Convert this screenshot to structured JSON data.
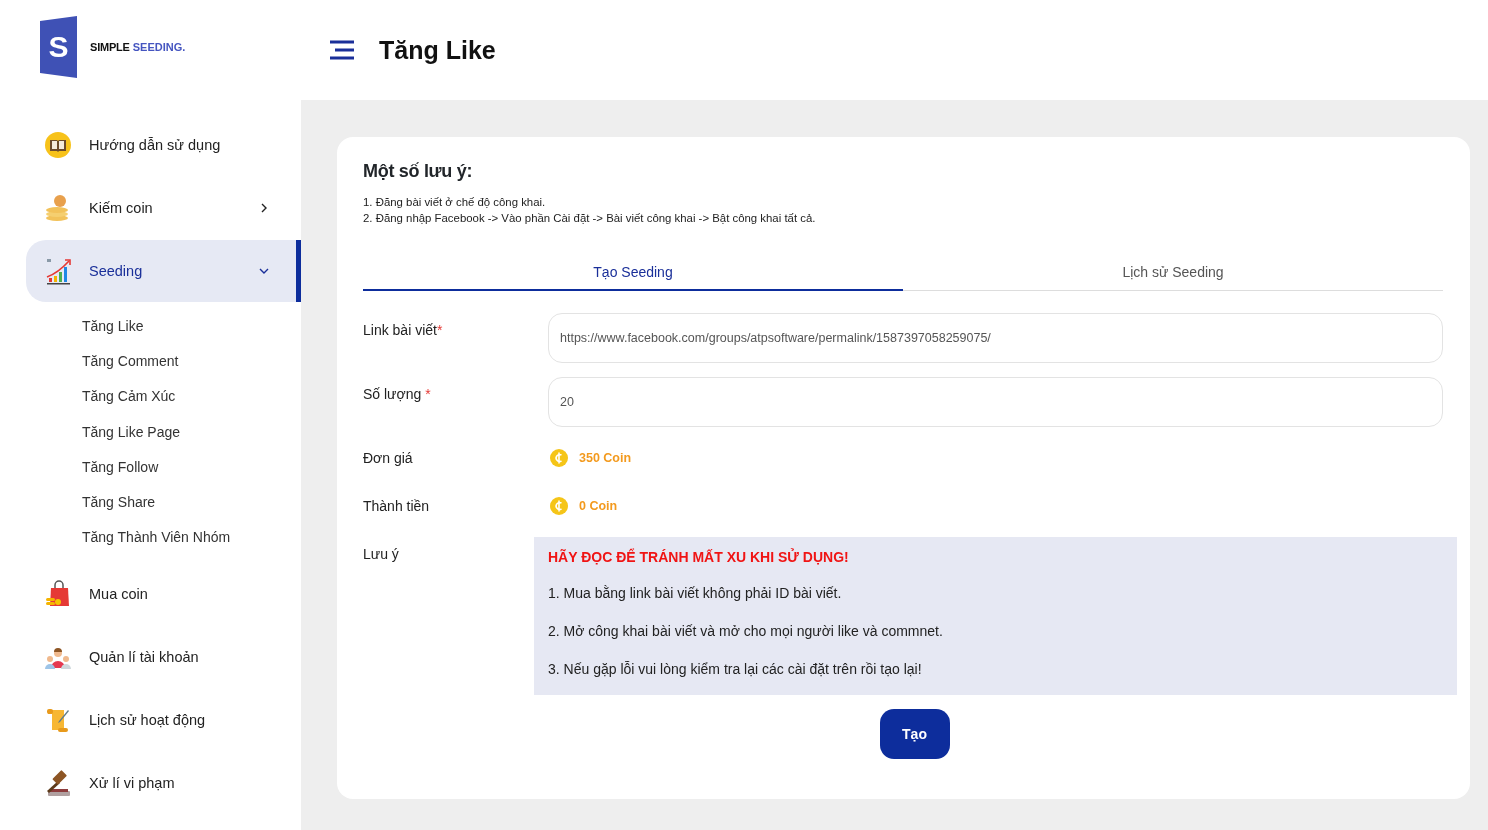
{
  "logo": {
    "mark": "S",
    "name": "SIMPLE",
    "accent": "SEEDING."
  },
  "sidebar": {
    "items": [
      {
        "label": "Hướng dẫn sử dụng",
        "selected": false
      },
      {
        "label": "Kiếm coin",
        "selected": false,
        "expanded": false
      },
      {
        "label": "Seeding",
        "selected": true,
        "expanded": true,
        "children": [
          {
            "label": "Tăng Like",
            "selected": false
          },
          {
            "label": "Tăng Comment",
            "selected": false
          },
          {
            "label": "Tăng Cảm Xúc",
            "selected": false
          },
          {
            "label": "Tăng Like Page",
            "selected": false
          },
          {
            "label": "Tăng Follow",
            "selected": false
          },
          {
            "label": "Tăng Share",
            "selected": false
          },
          {
            "label": "Tăng Thành Viên Nhóm",
            "selected": false
          }
        ]
      },
      {
        "label": "Mua coin",
        "selected": false
      },
      {
        "label": "Quản lí tài khoản",
        "selected": false
      },
      {
        "label": "Lịch sử hoạt động",
        "selected": false
      },
      {
        "label": "Xử lí vi phạm",
        "selected": false
      }
    ]
  },
  "header": {
    "title": "Tăng Like"
  },
  "notice": {
    "title": "Một số lưu ý:",
    "lines": [
      "1. Đăng bài viết ở chế độ công khai.",
      "2. Đăng nhập Facebook -> Vào phần Cài đặt -> Bài viết công khai -> Bật công khai tất cả."
    ]
  },
  "tabs": [
    {
      "label": "Tạo Seeding",
      "selected": true
    },
    {
      "label": "Lịch sử Seeding",
      "selected": false
    }
  ],
  "form": {
    "fields": [
      {
        "kind": "input",
        "label": "Link bài viết",
        "required": true,
        "value": "https://www.facebook.com/groups/atpsoftware/permalink/1587397058259075/"
      },
      {
        "kind": "input",
        "label": "Số lượng ",
        "required": true,
        "value": "20"
      },
      {
        "kind": "coin",
        "label": "Đơn giá",
        "value": "350 Coin"
      },
      {
        "kind": "coin",
        "label": "Thành tiền",
        "value": "0 Coin"
      },
      {
        "kind": "note",
        "label": "Lưu ý",
        "heading": "HÃY ĐỌC ĐỂ TRÁNH MẤT XU KHI SỬ DỤNG!",
        "lines": [
          "1. Mua bằng link bài viết không phải ID bài viết.",
          "2. Mở công khai bài viết và mở cho mọi người like và commnet.",
          "3. Nếu gặp lỗi vui lòng kiểm tra lại các cài đặt trên rồi tạo lại!"
        ]
      }
    ],
    "required_mark": "*",
    "submit": "Tạo"
  }
}
